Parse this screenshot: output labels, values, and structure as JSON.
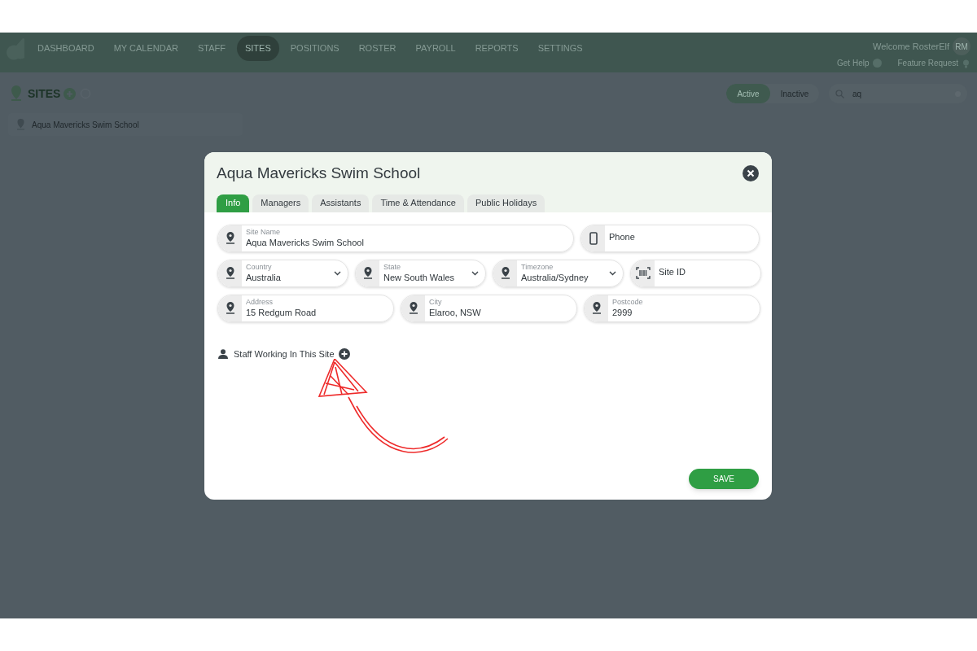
{
  "nav": {
    "items": [
      {
        "label": "DASHBOARD",
        "selected": false
      },
      {
        "label": "MY CALENDAR",
        "selected": false
      },
      {
        "label": "STAFF",
        "selected": false
      },
      {
        "label": "SITES",
        "selected": true
      },
      {
        "label": "POSITIONS",
        "selected": false
      },
      {
        "label": "ROSTER",
        "selected": false
      },
      {
        "label": "PAYROLL",
        "selected": false
      },
      {
        "label": "REPORTS",
        "selected": false
      },
      {
        "label": "SETTINGS",
        "selected": false
      }
    ],
    "welcome": "Welcome RosterElf",
    "avatar": "RM",
    "help": "Get Help",
    "feature_request": "Feature Request"
  },
  "page": {
    "title": "SITES",
    "filters": [
      {
        "label": "Active",
        "selected": true
      },
      {
        "label": "Inactive",
        "selected": false
      }
    ],
    "search": {
      "value": "aq"
    },
    "sites": [
      "Aqua Mavericks Swim School"
    ]
  },
  "modal": {
    "title": "Aqua Mavericks Swim School",
    "tabs": [
      {
        "label": "Info",
        "selected": true
      },
      {
        "label": "Managers",
        "selected": false
      },
      {
        "label": "Assistants",
        "selected": false
      },
      {
        "label": "Time & Attendance",
        "selected": false
      },
      {
        "label": "Public Holidays",
        "selected": false
      }
    ],
    "rows": [
      [
        {
          "kind": "location",
          "label": "Site Name",
          "value": "Aqua Mavericks Swim School"
        },
        {
          "kind": "phone",
          "label": "Phone"
        }
      ],
      [
        {
          "kind": "location-select",
          "label": "Country",
          "value": "Australia"
        },
        {
          "kind": "location-select",
          "label": "State",
          "value": "New South Wales"
        },
        {
          "kind": "location-select",
          "label": "Timezone",
          "value": "Australia/Sydney"
        },
        {
          "kind": "code",
          "label": "Site ID"
        }
      ],
      [
        {
          "kind": "location",
          "label": "Address",
          "value": "15 Redgum Road"
        },
        {
          "kind": "location",
          "label": "City",
          "value": "Elaroo, NSW"
        },
        {
          "kind": "location",
          "label": "Postcode",
          "value": "2999"
        }
      ]
    ],
    "staff_label": "Staff Working In This Site",
    "save": "SAVE"
  }
}
